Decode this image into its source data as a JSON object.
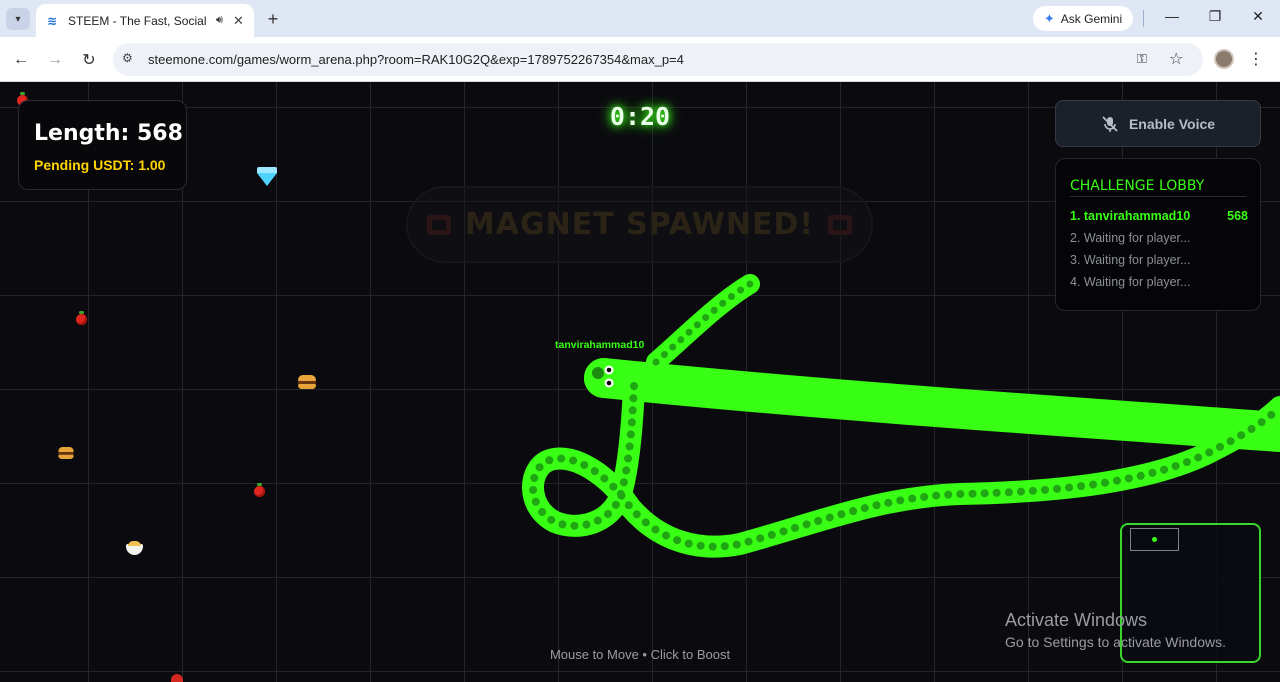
{
  "browser": {
    "tab_title": "STEEM - The Fast, Social Blo",
    "new_tab_icon": "plus-icon",
    "ask_gemini": "Ask Gemini",
    "url": "steemone.com/games/worm_arena.php?room=RAK10G2Q&exp=1789752267354&max_p=4"
  },
  "hud": {
    "length_text": "Length: 568",
    "pending_text": "Pending USDT: 1.00",
    "timer": "0:20",
    "notice_text": "MAGNET SPAWNED!",
    "voice_label": "Enable Voice",
    "hint": "Mouse to Move • Click to Boost"
  },
  "lobby": {
    "title": "CHALLENGE LOBBY",
    "players": [
      {
        "label": "1. tanvirahammad10",
        "score": "568"
      },
      {
        "label": "2. Waiting for player...",
        "score": ""
      },
      {
        "label": "3. Waiting for player...",
        "score": ""
      },
      {
        "label": "4. Waiting for player...",
        "score": ""
      }
    ]
  },
  "worm": {
    "player_name": "tanvirahammad10",
    "color": "#39ff14"
  },
  "watermark": {
    "line1": "Activate Windows",
    "line2": "Go to Settings to activate Windows."
  },
  "colors": {
    "accent_green": "#39ff14",
    "pending_yellow": "#ffd400",
    "background": "#0b0b0f"
  }
}
